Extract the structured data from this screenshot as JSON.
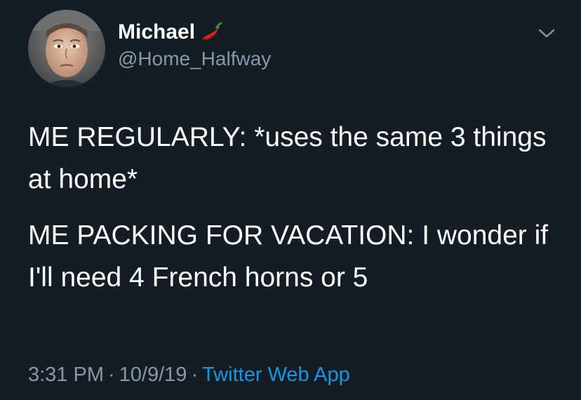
{
  "author": {
    "display_name": "Michael",
    "handle": "@Home_Halfway",
    "name_badge_icon": "hot-pepper-emoji",
    "avatar_icon": "profile-photo"
  },
  "menu": {
    "icon": "chevron-down-icon"
  },
  "tweet": {
    "paragraphs": [
      "ME REGULARLY: *uses the same 3 things at home*",
      "ME PACKING FOR VACATION: I wonder if I'll need 4 French horns or 5"
    ]
  },
  "meta": {
    "time": "3:31 PM",
    "separator": "·",
    "date": "10/9/19",
    "source": "Twitter Web App"
  },
  "colors": {
    "background": "#141d26",
    "primary_text": "#ffffff",
    "secondary_text": "#8899a6",
    "link": "#1b95e0"
  }
}
